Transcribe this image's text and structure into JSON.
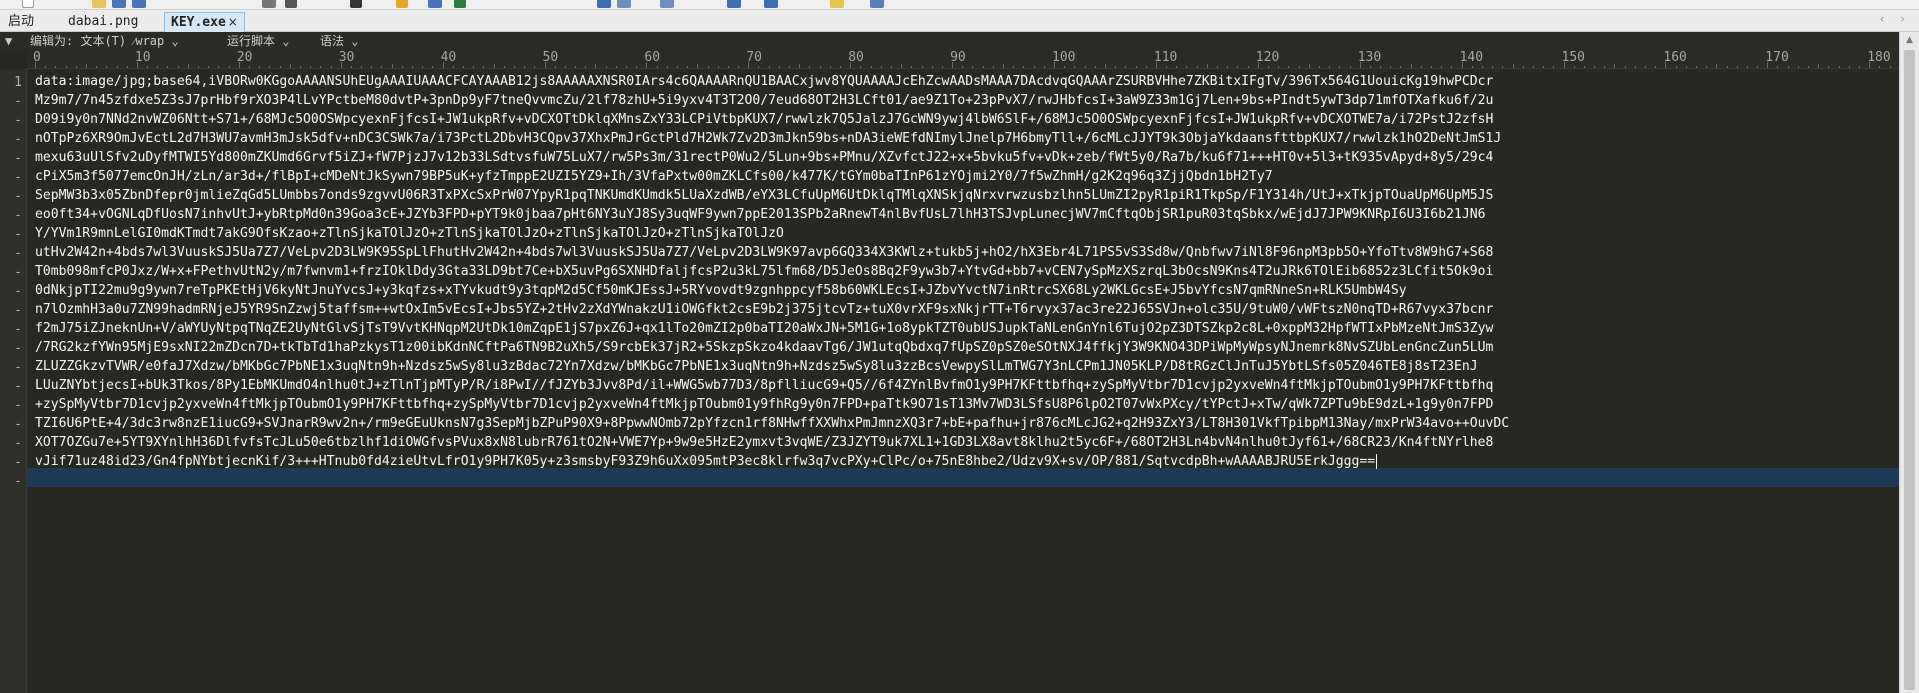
{
  "tabs": [
    {
      "label": "启动",
      "active": false
    },
    {
      "label": "dabai.png",
      "active": false
    },
    {
      "label": "KEY.exe",
      "active": true,
      "close": "×"
    }
  ],
  "tab_scroll_arrows": "‹ ›",
  "editbar": {
    "collapse": "▼",
    "encoding": "编辑为: 文本(T) ⁄wrap ⌄",
    "run_script": "运行脚本 ⌄",
    "syntax": "语法 ⌄"
  },
  "ruler": {
    "labels": [
      "0",
      "10",
      "20",
      "30",
      "40",
      "50",
      "60",
      "70",
      "80",
      "90",
      "100",
      "110",
      "120",
      "130",
      "140",
      "150",
      "160",
      "170",
      "180"
    ]
  },
  "gutter": [
    "1",
    "-",
    "-",
    "-",
    "-",
    "-",
    "-",
    "-",
    "-",
    "-",
    "-",
    "-",
    "-",
    "-",
    "-",
    "-",
    "-",
    "-",
    "-",
    "-",
    "-",
    "-"
  ],
  "code_lines": [
    "data:image/jpg;base64,iVBORw0KGgoAAAANSUhEUgAAAIUAAACFCAYAAAB12js8AAAAAXNSR0IArs4c6QAAAARnQU1BAACxjwv8YQUAAAAJcEhZcwAADsMAAA7DAcdvqGQAAArZSURBVHhe7ZKBitxIFgTv/396Tx564G1UouicKg19hwPCDcr",
    "Mz9m7/7n45zfdxe5Z3sJ7prHbf9rXO3P4lLvYPctbeM80dvtP+3pnDp9yF7tneQvvmcZu/2lf78zhU+5i9yxv4T3T2O0/7eud68OT2H3LCft01/ae9Z1To+23pPvX7/rwJHbfcsI+3aW9Z33m1Gj7Len+9bs+PIndt5ywT3dp71mfOTXafku6f/2u",
    "D09i9y0n7NNd2nvWZ06Ntt+S71+/68MJc5O0OSWpcyexnFjfcsI+JW1ukpRfv+vDCXOTtDklqXMnsZxY33LCPiVtbpKUX7/rwwlzk7Q5JalzJ7GcWN9ywj4lbW6SlF+/68MJc5O0OSWpcyexnFjfcsI+JW1ukpRfv+vDCXOTWE7a/i72PstJ2zfsH",
    "nOTpPz6XR9OmJvEctL2d7H3WU7avmH3mJsk5dfv+nDC3CSWk7a/i73PctL2DbvH3CQpv37XhxPmJrGctPld7H2Wk7Zv2D3mJkn59bs+nDA3ieWEfdNImylJnelp7H6bmyTll+/6cMLcJJYT9k3ObjaYkdaansfttbpKUX7/rwwlzk1hO2DeNtJmS1J",
    "mexu63uUlSfv2uDyfMTWI5Yd800mZKUmd6Grvf5iZJ+fW7PjzJ7v12b33LSdtvsfuW75LuX7/rw5Ps3m/31rectP0Wu2/5Lun+9bs+PMnu/XZvfctJ22+x+5bvku5fv+vDk+zeb/fWt5y0/Ra7b/ku6f71+++HT0v+5l3+tK935vApyd+8y5/29c4",
    "cPiX5m3f5077emcOnJH/zLn/ar3d+/flBpI+cMDeNtJkSywn79BP5uK+yfzTmppE2UZI5YZ9+Ih/3VfaPxtw00mZKLCfs00/k477K/tGYm0baTInP61zYOjmi2Y0/7f5wZhmH/g2K2q96q3ZjjQbdn1bH2Ty7",
    "SepMW3b3x05ZbnDfepr0jmlieZqGd5LUmbbs7onds9zgvvU06R3TxPXcSxPrW07YpyR1pqTNKUmdKUmdk5LUaXzdWB/eYX3LCfuUpM6UtDklqTMlqXNSkjqNrxvrwzusbzlhn5LUmZI2pyR1piR1TkpSp/F1Y314h/UtJ+xTkjpTOuaUpM6UpM5JS",
    "eo0ft34+vOGNLqDfUosN7inhvUtJ+ybRtpMd0n39Goa3cE+JZYb3FPD+pYT9k0jbaa7pHt6NY3uYJ8Sy3uqWF9ywn7ppE2013SPb2aRnewT4nlBvfUsL7lhH3TSJvpLunecjWV7mCftqObjSR1puR03tqSbkx/wEjdJ7JPW9KNRpI6U3I6b21JN6",
    "Y/YVm1R9mnLelGI0mdKTmdt7akG9OfsKzao+zTlnSjkaTOlJzO+zTlnSjkaTOlJzO+zTlnSjkaTOlJzO+zTlnSjkaTOlJzO",
    "utHv2W42n+4bds7wl3VuuskSJ5Ua7Z7/VeLpv2D3LW9K95SpLlFhutHv2W42n+4bds7wl3VuuskSJ5Ua7Z7/VeLpv2D3LW9K97avp6GQ334X3KWlz+tukb5j+hO2/hX3Ebr4L71PS5vS3Sd8w/Qnbfwv7iNl8F96npM3pb5O+YfoTtv8W9hG7+S68",
    "T0mb098mfcP0Jxz/W+x+FPethvUtN2y/m7fwnvm1+frzIOklDdy3Gta33LD9bt7Ce+bX5uvPg6SXNHDfaljfcsP2u3kL75lfm68/D5JeOs8Bq2F9yw3b7+YtvGd+bb7+vCEN7ySpMzXSzrqL3bOcsN9Kns4T2uJRk6TOlEib6852z3LCfit5Ok9oi",
    "0dNkjpTI22mu9g9ywn7reTpPKEtHjV6kyNtJnuYvcsJ+y3kqfzs+xTYvkudt9y3tqpM2d5Cf50mKJEssJ+5RYvovdt9zgnhppcyf58b60WKLEcsI+JZbvYvctN7inRtrcSX68Ly2WKLGcsE+J5bvYfcsN7qmRNneSn+RLK5UmbW4Sy",
    "n7lOzmhH3a0u7ZN99hadmRNjeJ5YR9SnZzwj5taffsm++wtOxIm5vEcsI+Jbs5YZ+2tHv2zXdYWnakzU1iOWGfkt2csE9b2j375jtcvTz+tuX0vrXF9sxNkjrTT+T6rvyx37ac3re22J65SVJn+olc35U/9tuW0/vWFtszN0nqTD+R67vyx37bcnr",
    "f2mJ75iZJneknUn+V/aWYUyNtpqTNqZE2UyNtGlvSjTsT9VvtKHNqpM2UtDk10mZqpE1jS7pxZ6J+qx1lTo20mZI2p0baTI20aWxJN+5M1G+1o8ypkTZT0ubUSJupkTaNLenGnYnl6TujO2pZ3DTSZkp2c8L+0xppM32HpfWTIxPbMzeNtJmS3Zyw",
    "/7RG2kzfYWn95MjE9sxNI22mZDcn7D+tkTbTd1haPzkysT1z00ibKdnNCftPa6TN9B2uXh5/S9rcbEk37jR2+5SkzpSkzo4kdaavTg6/JW1utqQbdxq7fUpSZ0pSZ0eSOtNXJ4ffkjY3W9KNO43DPiWpMyWpsyNJnemrk8NvSZUbLenGncZun5LUm",
    "ZLUZZGkzvTVWR/e0faJ7Xdzw/bMKbGc7PbNE1x3uqNtn9h+Nzdsz5wSy8lu3zBdac72Yn7Xdzw/bMKbGc7PbNE1x3uqNtn9h+Nzdsz5wSy8lu3zzBcsVewpySlLmTWG7Y3nLCPm1JN05KLP/D8tRGzClJnTuJ5YbtLSfs05Z046TE8j8sT23EnJ",
    "LUuZNYbtjecsI+bUk3Tkos/8Py1EbMKUmdO4nlhu0tJ+zTlnTjpMTyP/R/i8PwI//fJZYb3Jvv8Pd/il+WWG5wb77D3/8pflliucG9+Q5//6f4ZYnlBvfmO1y9PH7KFttbfhq+zySpMyVtbr7D1cvjp2yxveWn4ftMkjpTOubmO1y9PH7KFttbfhq",
    "+zySpMyVtbr7D1cvjp2yxveWn4ftMkjpTOubmO1y9PH7KFttbfhq+zySpMyVtbr7D1cvjp2yxveWn4ftMkjpTOubm01y9fhRg9y0n7FPD+paTtk9O71sT13Mv7WD3LSfsU8P6lpO2T07vWxPXcy/tYPctJ+xTw/qWk7ZPTu9bE9dzL+1g9y0n7FPD",
    "TZI6U6PtE+4/3dc3rw8nzE1iucG9+SVJnarR9wv2n+/rm9eGEuUknsN7g3SepMjbZPuP90X9+8PpwwNOmb72pYfzcn1rf8NHwffXXWhxPmJmnzXQ3r7+bE+pafhu+jr876cMLcJG2+q2H93ZxY3/LT8H301VkfTpibpM13Nay/mxPrW34avo++OuvDC",
    "XOT7OZGu7e+5YT9XYnlhH36DlfvfsTcJLu50e6tbzlhf1diOWGfvsPVux8xN8lubrR761tO2N+VWE7Yp+9w9e5HzE2ymxvt3vqWE/Z3JZYT9uk7XL1+1GD3LX8avt8klhu2t5yc6F+/68OT2H3Ln4bvN4nlhu0tJyf61+/68CR23/Kn4ftNYrlhe8",
    "vJif71uz48id23/Gn4fpNYbtjecnKif/3+++HTnub0fd4zieUtvLfrO1y9PH7K05y+z3smsbyF93Z9h6uXx095mtP3ec8klrfw3q7vcPXy+ClPc/o+75nE8hbe2/Udzv9X+sv/OP/881/SqtvcdpBh+wAAAABJRU5ErkJggg=="
  ],
  "colors": {
    "editor_bg": "#272822",
    "text": "#f8f8f2",
    "current_line": "#1c3957",
    "tab_active": "#d6e8f7"
  }
}
